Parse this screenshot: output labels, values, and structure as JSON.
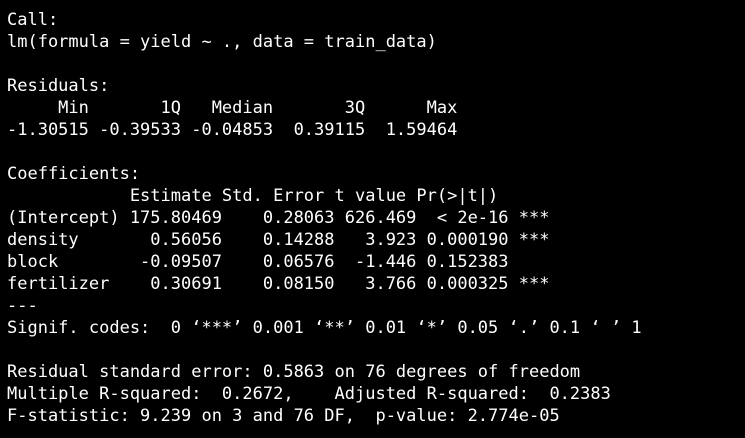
{
  "call": {
    "header": "Call:",
    "formula": "lm(formula = yield ~ ., data = train_data)"
  },
  "residuals": {
    "header": "Residuals:",
    "labels": "     Min       1Q   Median       3Q      Max ",
    "values": "-1.30515 -0.39533 -0.04853  0.39115  1.59464 "
  },
  "coefficients": {
    "header": "Coefficients:",
    "columns": "            Estimate Std. Error t value Pr(>|t|)    ",
    "rows": [
      "(Intercept) 175.80469    0.28063 626.469  < 2e-16 ***",
      "density       0.56056    0.14288   3.923 0.000190 ***",
      "block        -0.09507    0.06576  -1.446 0.152383    ",
      "fertilizer    0.30691    0.08150   3.766 0.000325 ***"
    ],
    "separator": "---",
    "signif": "Signif. codes:  0 ‘***’ 0.001 ‘**’ 0.01 ‘*’ 0.05 ‘.’ 0.1 ‘ ’ 1"
  },
  "summary": {
    "rse": "Residual standard error: 0.5863 on 76 degrees of freedom",
    "r2": "Multiple R-squared:  0.2672,\tAdjusted R-squared:  0.2383 ",
    "fstat": "F-statistic: 9.239 on 3 and 76 DF,  p-value: 2.774e-05"
  }
}
